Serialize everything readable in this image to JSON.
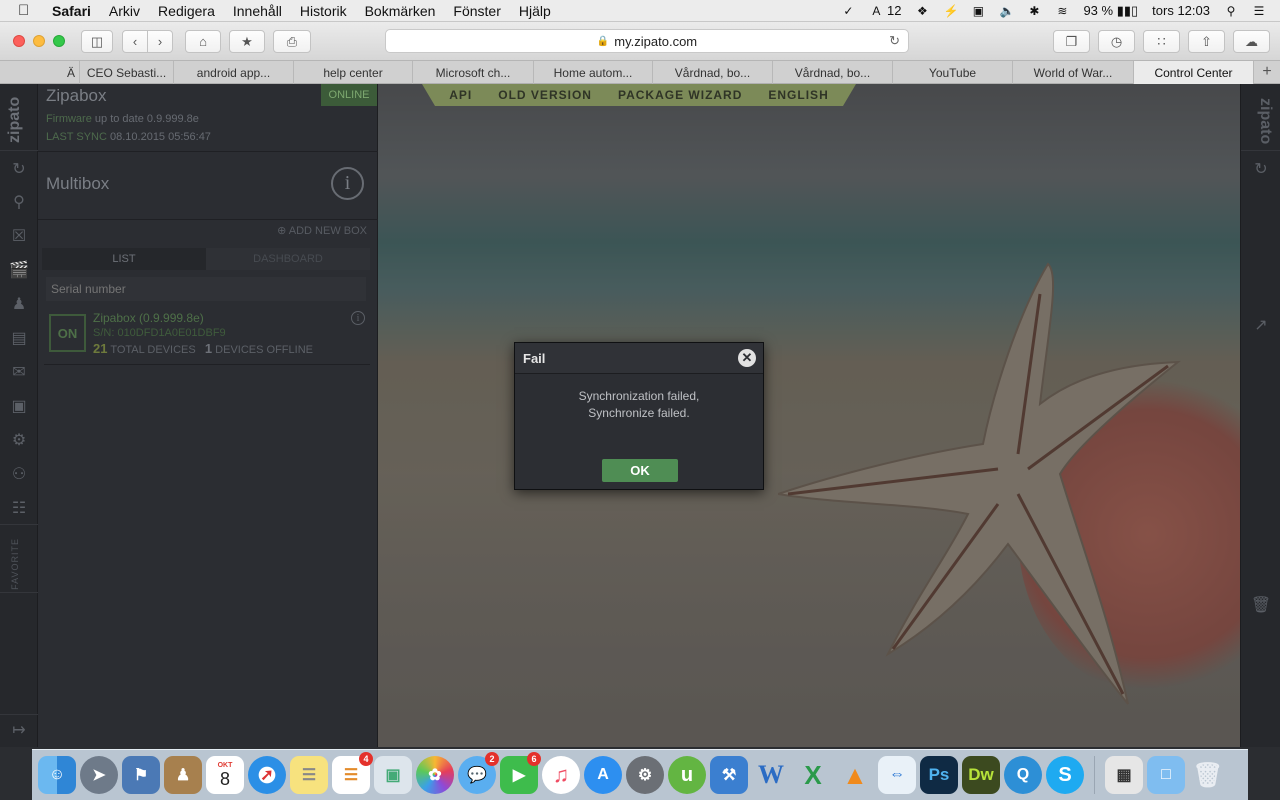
{
  "menubar": {
    "app": "Safari",
    "items": [
      "Arkiv",
      "Redigera",
      "Innehåll",
      "Historik",
      "Bokmärken",
      "Fönster",
      "Hjälp"
    ],
    "notification_count": "12",
    "battery": "93 %",
    "clock": "tors 12:03"
  },
  "browser": {
    "url": "my.zipato.com",
    "tabs": [
      {
        "label": "Ä"
      },
      {
        "label": "CEO Sebasti..."
      },
      {
        "label": "android app..."
      },
      {
        "label": "help center"
      },
      {
        "label": "Microsoft ch..."
      },
      {
        "label": "Home autom..."
      },
      {
        "label": "Vårdnad, bo..."
      },
      {
        "label": "Vårdnad, bo..."
      },
      {
        "label": "YouTube"
      },
      {
        "label": "World of War..."
      },
      {
        "label": "Control Center"
      }
    ]
  },
  "topnav": [
    "API",
    "OLD VERSION",
    "PACKAGE WIZARD",
    "ENGLISH"
  ],
  "rail": {
    "brand": "zipato",
    "favorite_label": "FAVORITE"
  },
  "panel": {
    "box_name": "Zipabox",
    "status": "ONLINE",
    "firmware_label": "Firmware",
    "firmware_text": "up to date 0.9.999.8e",
    "sync_label": "LAST SYNC",
    "sync_time": "08.10.2015 05:56:47",
    "section_title": "Multibox",
    "add_new_box": "ADD NEW BOX",
    "tab_list": "LIST",
    "tab_dashboard": "DASHBOARD",
    "serial_placeholder": "Serial number",
    "device": {
      "state": "ON",
      "name": "Zipabox (0.9.999.8e)",
      "serial": "S/N: 010DFD1A0E01DBF9",
      "total_devices": "21",
      "total_label": "TOTAL DEVICES",
      "offline_devices": "1",
      "offline_label": "DEVICES OFFLINE"
    }
  },
  "right_rail": {
    "brand": "zipato"
  },
  "dialog": {
    "title": "Fail",
    "message_line1": "Synchronization failed,",
    "message_line2": "Synchronize failed.",
    "ok_label": "OK"
  },
  "dock": {
    "calendar_month": "OKT",
    "calendar_day": "8",
    "reminders_badge": "4",
    "messages_badge": "2",
    "facetime_badge": "6"
  },
  "colors": {
    "accent_green": "#4f8d54",
    "online_green": "#3c5b39",
    "nav_olive": "#7c8a58"
  }
}
